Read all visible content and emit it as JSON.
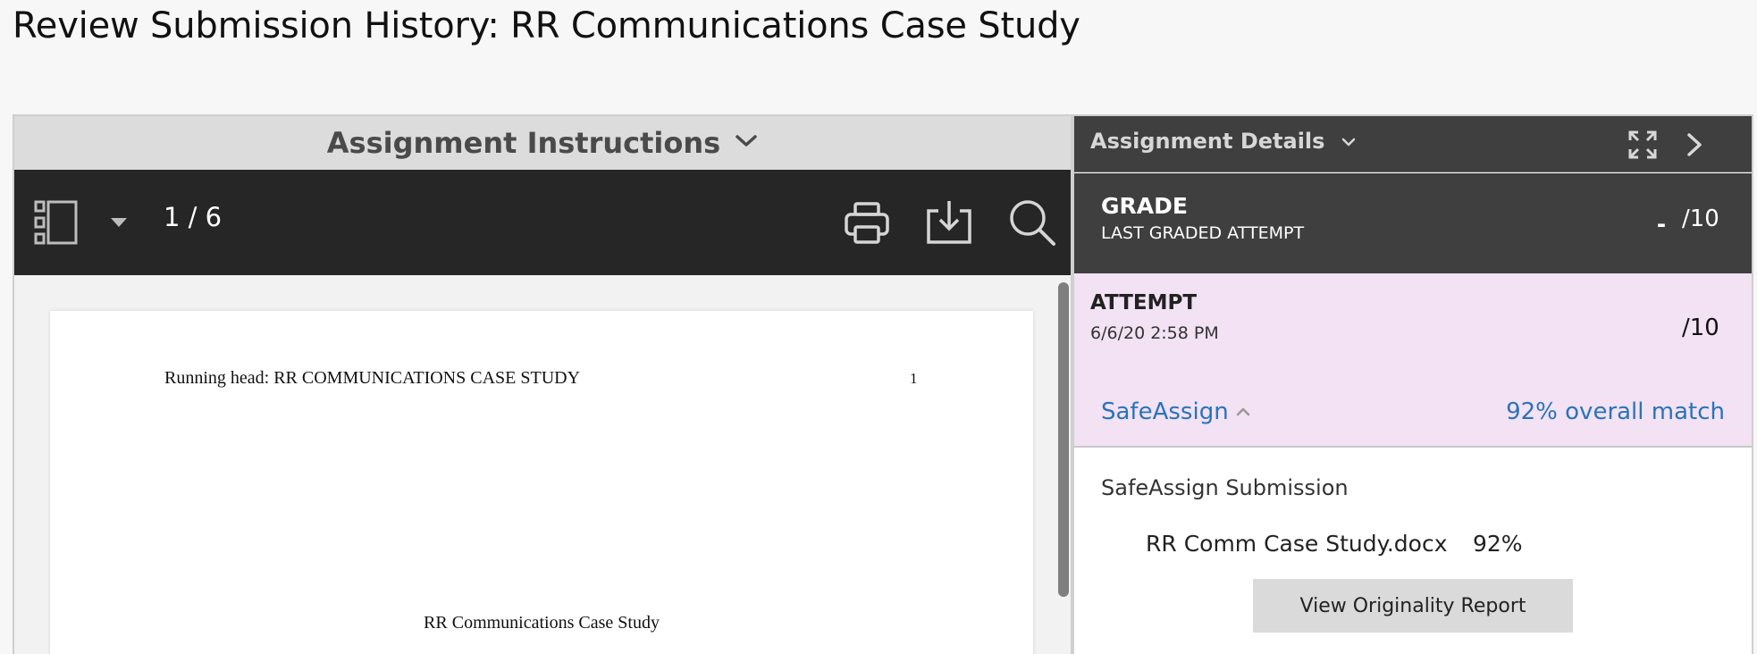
{
  "page": {
    "title": "Review Submission History: RR Communications Case Study"
  },
  "viewer": {
    "header_title": "Assignment Instructions",
    "page_indicator": "1 / 6",
    "document": {
      "running_head": "Running head: RR COMMUNICATIONS CASE STUDY",
      "page_number": "1",
      "title": "RR Communications Case Study"
    }
  },
  "details": {
    "header_title": "Assignment Details",
    "grade": {
      "label": "GRADE",
      "sublabel": "LAST GRADED ATTEMPT",
      "dash": "-",
      "value": "/10"
    },
    "attempt": {
      "label": "ATTEMPT",
      "date": "6/6/20 2:58 PM",
      "value": "/10"
    },
    "safeassign": {
      "label": "SafeAssign",
      "overall_match": "92% overall match",
      "submission_title": "SafeAssign Submission",
      "file_name": "RR Comm Case Study.docx",
      "file_percent": "92%",
      "report_button": "View Originality Report"
    }
  },
  "colors": {
    "toolbar_bg": "#262626",
    "panel_dark": "#3f3f3f",
    "attempt_bg": "#f2e2f4",
    "link_blue": "#2a73b8"
  },
  "icons": [
    "sidebar-toggle-icon",
    "chevron-down-icon",
    "print-icon",
    "download-icon",
    "search-icon",
    "expand-icon",
    "chevron-right-icon",
    "chevron-up-icon"
  ]
}
